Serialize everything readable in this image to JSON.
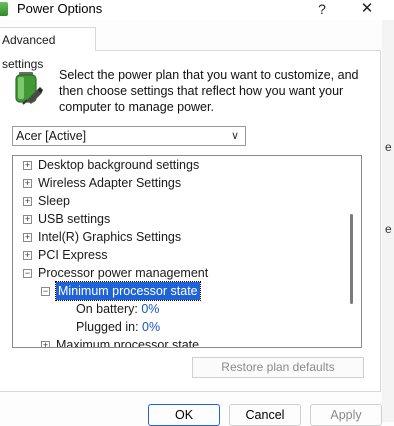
{
  "window": {
    "title": "Power Options",
    "help_label": "?",
    "close_label": "✕"
  },
  "tab": {
    "label": "Advanced settings"
  },
  "intro_text": "Select the power plan that you want to customize, and then choose settings that reflect how you want your computer to manage power.",
  "plan_select": {
    "value": "Acer [Active]"
  },
  "tree": {
    "items": [
      {
        "label": "Desktop background settings",
        "expander": "+"
      },
      {
        "label": "Wireless Adapter Settings",
        "expander": "+"
      },
      {
        "label": "Sleep",
        "expander": "+"
      },
      {
        "label": "USB settings",
        "expander": "+"
      },
      {
        "label": "Intel(R) Graphics Settings",
        "expander": "+"
      },
      {
        "label": "PCI Express",
        "expander": "+"
      },
      {
        "label": "Processor power management",
        "expander": "−"
      },
      {
        "label": "Minimum processor state",
        "expander": "−"
      },
      {
        "label": "On battery:",
        "value": "0%"
      },
      {
        "label": "Plugged in:",
        "value": "0%"
      },
      {
        "label": "Maximum processor state",
        "expander": "+"
      }
    ]
  },
  "buttons": {
    "restore": "Restore plan defaults",
    "ok": "OK",
    "cancel": "Cancel",
    "apply": "Apply"
  },
  "background_text": {
    "a": "e",
    "b": "e"
  },
  "colors": {
    "selection": "#1e63d8",
    "link": "#1a56c4",
    "disabled_text": "#8a8a8a"
  }
}
